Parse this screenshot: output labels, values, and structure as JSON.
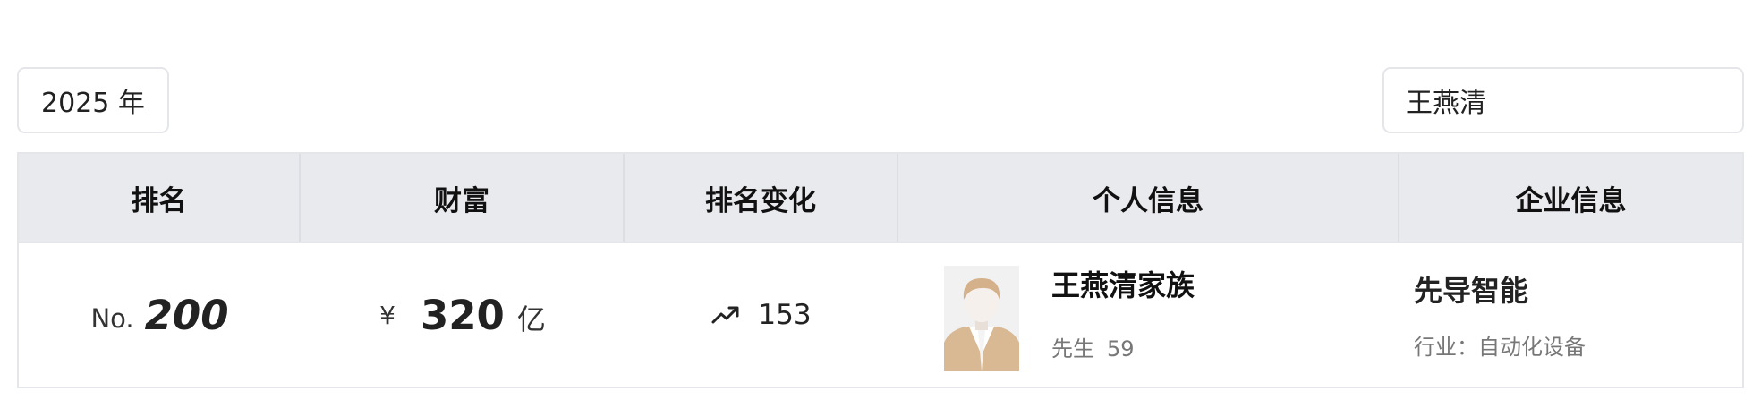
{
  "filters": {
    "year": "2025 年",
    "search_value": "王燕清"
  },
  "table": {
    "headers": [
      "排名",
      "财富",
      "排名变化",
      "个人信息",
      "企业信息"
    ],
    "rows": [
      {
        "rank_prefix": "No.",
        "rank": "200",
        "currency": "¥",
        "wealth": "320",
        "wealth_unit": "亿",
        "change_icon": "trending-up-icon",
        "change": "153",
        "avatar_icon": "person-avatar-icon",
        "name": "王燕清家族",
        "title": "先生",
        "age": "59",
        "company": "先导智能",
        "industry": "行业：自动化设备"
      }
    ]
  }
}
